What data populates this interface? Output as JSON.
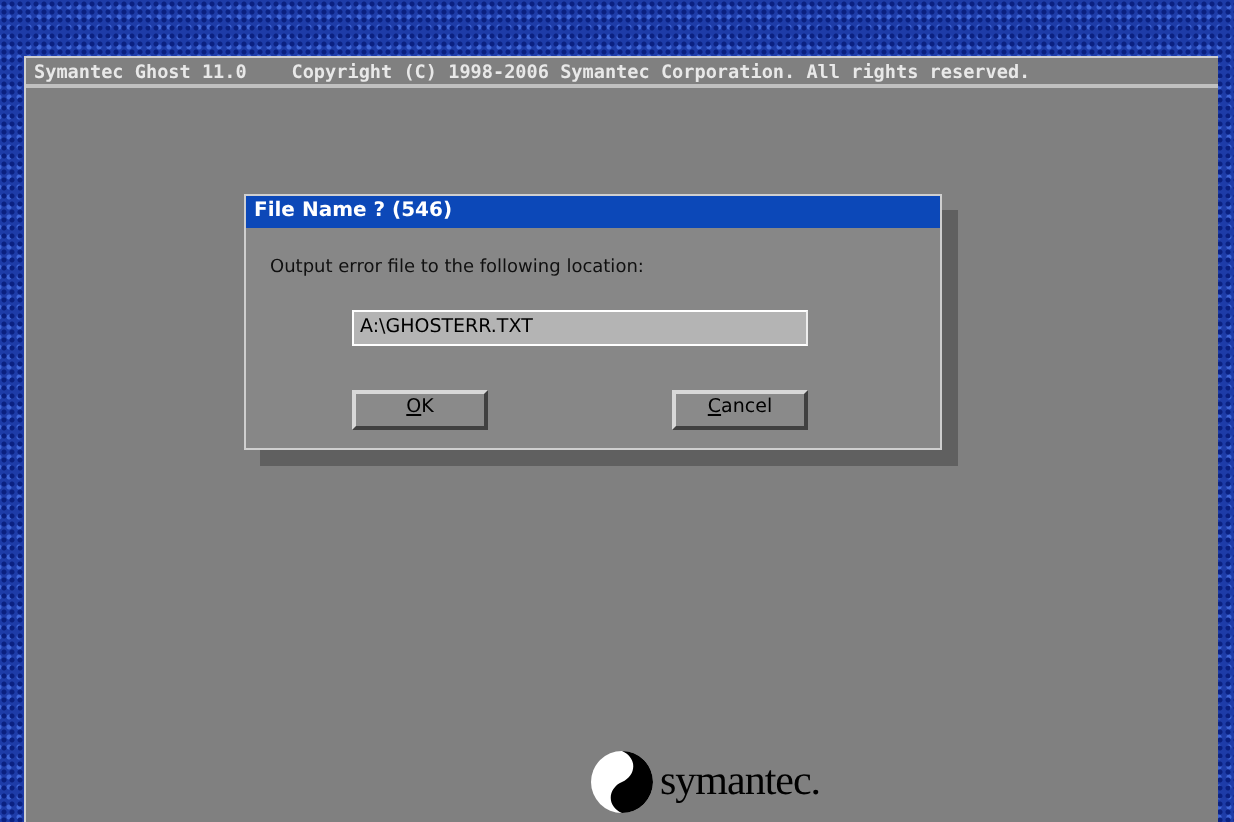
{
  "window": {
    "title": "Symantec Ghost 11.0    Copyright (C) 1998-2006 Symantec Corporation. All rights reserved."
  },
  "dialog": {
    "title": "File Name ? (546)",
    "prompt": "Output error file to the following location:",
    "field": {
      "value": "A:\\GHOSTERR.TXT"
    },
    "buttons": [
      {
        "label": "OK"
      },
      {
        "label": "Cancel"
      }
    ]
  },
  "logo": {
    "text": "symantec."
  }
}
